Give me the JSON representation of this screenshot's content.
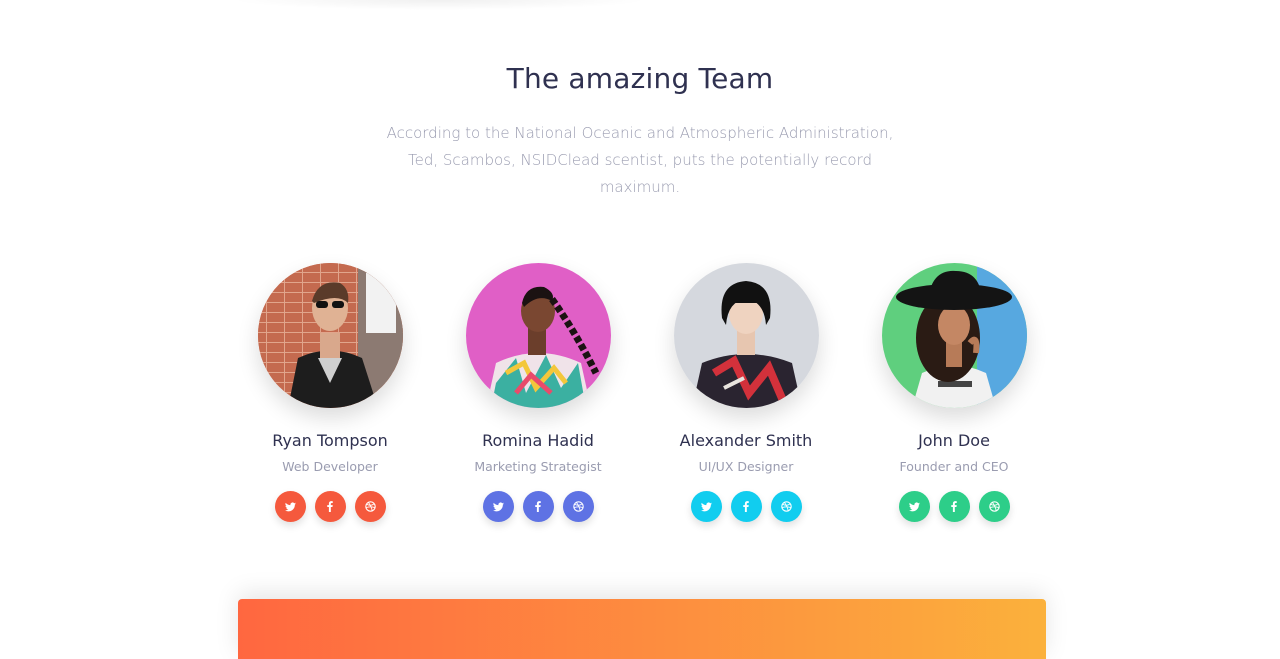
{
  "section": {
    "title": "The amazing Team",
    "subtitle": "According to the National Oceanic and Atmospheric Administration, Ted, Scambos, NSIDClead scentist, puts the potentially record maximum."
  },
  "members": [
    {
      "name": "Ryan Tompson",
      "role": "Web Developer",
      "color": "#f5593d"
    },
    {
      "name": "Romina Hadid",
      "role": "Marketing Strategist",
      "color": "#5e72e4"
    },
    {
      "name": "Alexander Smith",
      "role": "UI/UX Designer",
      "color": "#11cdef"
    },
    {
      "name": "John Doe",
      "role": "Founder and CEO",
      "color": "#2dce89"
    }
  ],
  "social_icons": [
    "twitter-icon",
    "facebook-icon",
    "dribbble-icon"
  ],
  "banner": {
    "gradient": [
      "#ff6740",
      "#fbb13c"
    ]
  }
}
